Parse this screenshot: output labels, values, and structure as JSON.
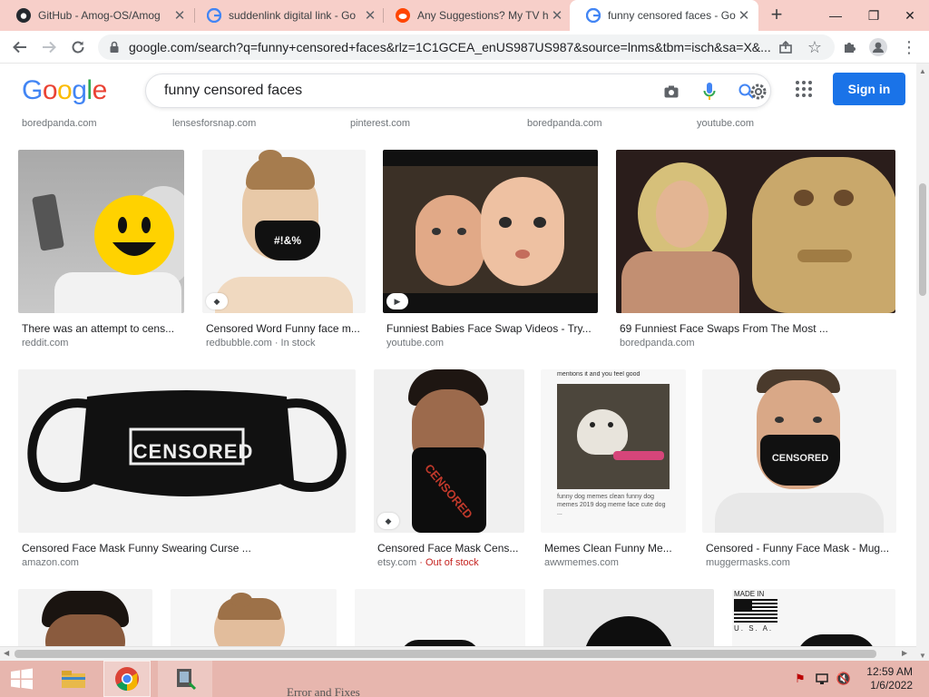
{
  "tabs": [
    {
      "title": "GitHub - Amog-OS/Amog",
      "icon": "github-icon"
    },
    {
      "title": "suddenlink digital link - Go",
      "icon": "google-icon"
    },
    {
      "title": "Any Suggestions? My TV h",
      "icon": "reddit-icon"
    },
    {
      "title": "funny censored faces - Go",
      "icon": "google-icon"
    }
  ],
  "address_bar": {
    "url": "google.com/search?q=funny+censored+faces&rlz=1C1GCEA_enUS987US987&source=lnms&tbm=isch&sa=X&..."
  },
  "header": {
    "logo": [
      {
        "ch": "G",
        "color": "#4285f4"
      },
      {
        "ch": "o",
        "color": "#ea4335"
      },
      {
        "ch": "o",
        "color": "#fbbc05"
      },
      {
        "ch": "g",
        "color": "#4285f4"
      },
      {
        "ch": "l",
        "color": "#34a853"
      },
      {
        "ch": "e",
        "color": "#ea4335"
      }
    ],
    "query": "funny censored faces",
    "sign_in": "Sign in"
  },
  "top_sources": [
    "boredpanda.com",
    "lensesforsnap.com",
    "pinterest.com",
    "boredpanda.com",
    "youtube.com"
  ],
  "row1": [
    {
      "title": "There was an attempt to cens...",
      "site": "reddit.com",
      "extra": ""
    },
    {
      "title": "Censored Word Funny face m...",
      "site": "redbubble.com",
      "extra": " · In stock"
    },
    {
      "title": "Funniest Babies Face Swap Videos - Try...",
      "site": "youtube.com",
      "extra": ""
    },
    {
      "title": "69 Funniest Face Swaps From The Most ...",
      "site": "boredpanda.com",
      "extra": ""
    }
  ],
  "row2": [
    {
      "title": "Censored Face Mask Funny Swearing Curse ...",
      "site": "amazon.com",
      "extra": ""
    },
    {
      "title": "Censored Face Mask Cens...",
      "site": "etsy.com",
      "extra": " · Out of stock"
    },
    {
      "title": "Memes Clean Funny Me...",
      "site": "awwmemes.com",
      "extra": ""
    },
    {
      "title": "Censored - Funny Face Mask - Mug...",
      "site": "muggermasks.com",
      "extra": ""
    }
  ],
  "image_text": {
    "mask_word": "CENSORED",
    "symbols": "#!&%",
    "meme_caption": "mentions it and you feel good",
    "meme_sub": "funny dog memes clean funny dog memes 2019 dog meme face cute dog ...",
    "made_in": "MADE IN",
    "usa": "U. S. A."
  },
  "taskbar": {
    "time": "12:59 AM",
    "date": "1/6/2022",
    "peek_text": "Error and Fixes"
  },
  "colors": {
    "accent": "#1a73e8",
    "tabbar": "#f7cfc9",
    "taskbar": "#e7b6ae"
  }
}
